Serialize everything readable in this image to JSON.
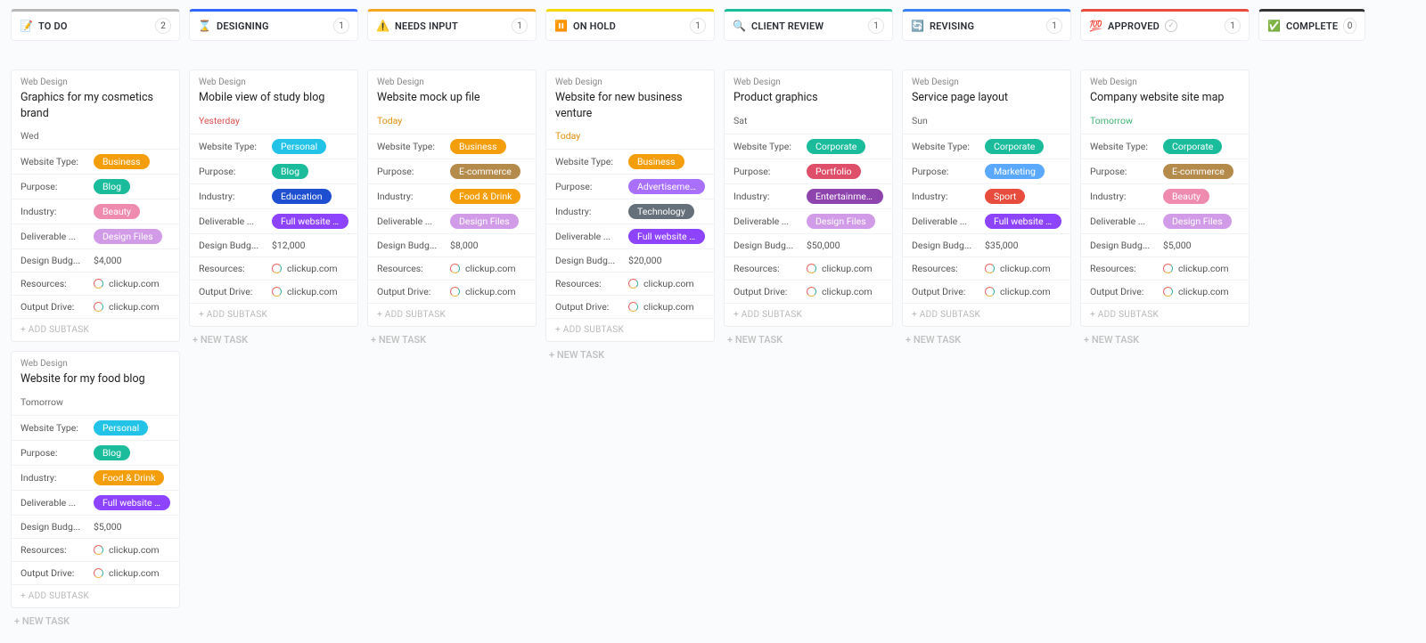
{
  "labels": {
    "add_subtask": "+ ADD SUBTASK",
    "new_task": "+ NEW TASK"
  },
  "field_keys": {
    "website_type": "Website Type:",
    "purpose": "Purpose:",
    "industry": "Industry:",
    "deliverable": "Deliverable ...",
    "budget": "Design Budg...",
    "resources": "Resources:",
    "output_drive": "Output Drive:"
  },
  "tag_colors": {
    "Business": "#f59e0b",
    "Personal": "#22c3e6",
    "Corporate": "#1abc9c",
    "Blog": "#1abc9c",
    "E-commerce": "#b58b4c",
    "Advertisement": "#a970ff",
    "Portfolio": "#e04f6a",
    "Marketing": "#5aa9ff",
    "Beauty": "#f08bb0",
    "Education": "#1f4fd1",
    "Food & Drink": "#f59e0b",
    "Technology": "#66707a",
    "Entertainment": "#8e44ad",
    "Sport": "#e74c3c",
    "Design Files": "#d19be8",
    "Full website design and lay...": "#8e44ff"
  },
  "columns": [
    {
      "emoji": "📝",
      "label": "TO DO",
      "count": "2",
      "accent": "#b9b9b9",
      "cards": [
        {
          "category": "Web Design",
          "title": "Graphics for my cosmetics brand",
          "date": "Wed",
          "date_class": "",
          "website_type": "Business",
          "purpose": "Blog",
          "industry": "Beauty",
          "deliverable": "Design Files",
          "budget": "$4,000",
          "resources": "clickup.com",
          "output_drive": "clickup.com"
        },
        {
          "category": "Web Design",
          "title": "Website for my food blog",
          "date": "Tomorrow",
          "date_class": "",
          "website_type": "Personal",
          "purpose": "Blog",
          "industry": "Food & Drink",
          "deliverable": "Full website design and lay...",
          "budget": "$5,000",
          "resources": "clickup.com",
          "output_drive": "clickup.com"
        }
      ]
    },
    {
      "emoji": "⌛",
      "label": "DESIGNING",
      "count": "1",
      "accent": "#3366ff",
      "cards": [
        {
          "category": "Web Design",
          "title": "Mobile view of study blog",
          "date": "Yesterday",
          "date_class": "red",
          "website_type": "Personal",
          "purpose": "Blog",
          "industry": "Education",
          "deliverable": "Full website design and lay...",
          "budget": "$12,000",
          "resources": "clickup.com",
          "output_drive": "clickup.com"
        }
      ]
    },
    {
      "emoji": "⚠️",
      "label": "NEEDS INPUT",
      "count": "1",
      "accent": "#f5a623",
      "cards": [
        {
          "category": "Web Design",
          "title": "Website mock up file",
          "date": "Today",
          "date_class": "orange",
          "website_type": "Business",
          "purpose": "E-commerce",
          "industry": "Food & Drink",
          "deliverable": "Design Files",
          "budget": "$8,000",
          "resources": "clickup.com",
          "output_drive": "clickup.com"
        }
      ]
    },
    {
      "emoji": "⏸️",
      "label": "ON HOLD",
      "count": "1",
      "accent": "#f5d90a",
      "cards": [
        {
          "category": "Web Design",
          "title": "Website for new business venture",
          "date": "Today",
          "date_class": "orange",
          "website_type": "Business",
          "purpose": "Advertisement",
          "industry": "Technology",
          "deliverable": "Full website design and lay...",
          "budget": "$20,000",
          "resources": "clickup.com",
          "output_drive": "clickup.com"
        }
      ]
    },
    {
      "emoji": "🔍",
      "label": "CLIENT REVIEW",
      "count": "1",
      "accent": "#1abc9c",
      "cards": [
        {
          "category": "Web Design",
          "title": "Product graphics",
          "date": "Sat",
          "date_class": "",
          "website_type": "Corporate",
          "purpose": "Portfolio",
          "industry": "Entertainment",
          "deliverable": "Design Files",
          "budget": "$50,000",
          "resources": "clickup.com",
          "output_drive": "clickup.com"
        }
      ]
    },
    {
      "emoji": "🔄",
      "label": "REVISING",
      "count": "1",
      "accent": "#3b82f6",
      "cards": [
        {
          "category": "Web Design",
          "title": "Service page layout",
          "date": "Sun",
          "date_class": "",
          "website_type": "Corporate",
          "purpose": "Marketing",
          "industry": "Sport",
          "deliverable": "Full website design and lay...",
          "budget": "$35,000",
          "resources": "clickup.com",
          "output_drive": "clickup.com"
        }
      ]
    },
    {
      "emoji": "💯",
      "label": "APPROVED",
      "count": "1",
      "accent": "#e74c3c",
      "show_status_dot": true,
      "cards": [
        {
          "category": "Web Design",
          "title": "Company website site map",
          "date": "Tomorrow",
          "date_class": "green",
          "website_type": "Corporate",
          "purpose": "E-commerce",
          "industry": "Beauty",
          "deliverable": "Design Files",
          "budget": "$5,000",
          "resources": "clickup.com",
          "output_drive": "clickup.com"
        }
      ]
    },
    {
      "emoji": "✅",
      "label": "COMPLETE",
      "count": "0",
      "accent": "#333",
      "narrow": true,
      "cards": []
    }
  ]
}
